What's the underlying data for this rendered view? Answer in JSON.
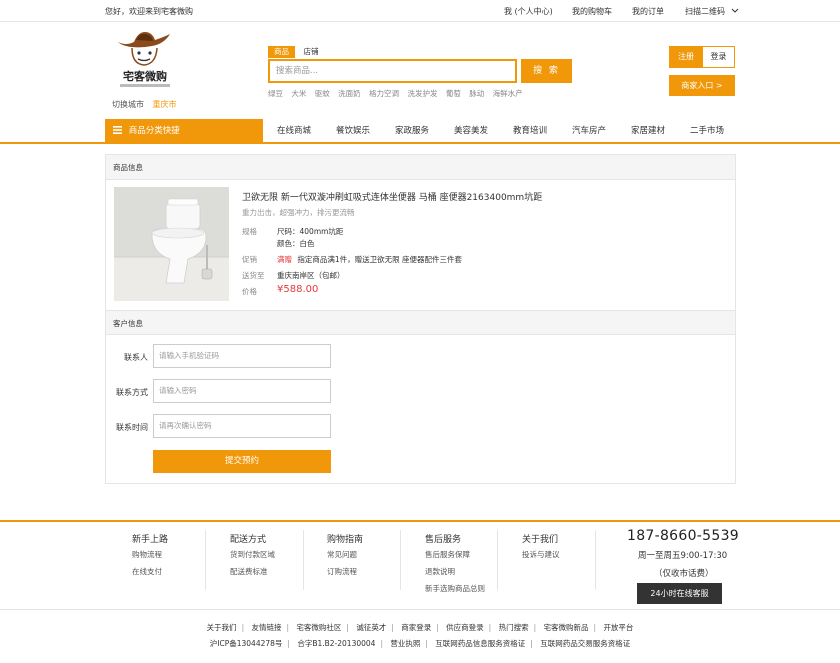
{
  "topbar": {
    "greeting": "您好，欢迎来到宅客微购",
    "links": [
      "我 (个人中心)",
      "我的购物车",
      "我的订单",
      "扫描二维码"
    ]
  },
  "header": {
    "logo_text": "宅客微购",
    "city_label": "切换城市",
    "city_current": "重庆市",
    "search_tabs": [
      "商品",
      "店铺"
    ],
    "search_placeholder": "搜索商品...",
    "search_button": "搜 索",
    "hotwords": [
      "绿豆",
      "大米",
      "驱蚊",
      "洗面奶",
      "格力空调",
      "洗发护发",
      "葡萄",
      "脉动",
      "海鲜水产"
    ],
    "register": "注册",
    "login": "登录",
    "merchant": "商家入口 >"
  },
  "nav": {
    "category": "商品分类快捷",
    "items": [
      "在线商城",
      "餐饮娱乐",
      "家政服务",
      "美容美发",
      "教育培训",
      "汽车房产",
      "家居建材",
      "二手市场"
    ]
  },
  "product": {
    "section_title": "商品信息",
    "title": "卫欲无限 新一代双漩冲刷虹吸式连体坐便器 马桶 座便器2163400mm坑距",
    "subtitle": "重力出击，超强冲力，排污更流畅",
    "spec_label": "规格",
    "spec_size": "尺码：400mm坑距",
    "spec_color": "颜色：白色",
    "promo_label": "促销",
    "promo_tag": "满赠",
    "promo_text": "指定商品满1件，赠送卫欲无限 座便器配件三件套",
    "ship_label": "送货至",
    "ship_value": "重庆南岸区（包邮）",
    "price_label": "价格",
    "price": "¥588.00"
  },
  "customer": {
    "section_title": "客户信息",
    "fields": [
      {
        "label": "联系人",
        "placeholder": "请输入手机验证码"
      },
      {
        "label": "联系方式",
        "placeholder": "请输入密码"
      },
      {
        "label": "联系时间",
        "placeholder": "请再次确认密码"
      }
    ],
    "submit": "提交预约"
  },
  "footer": {
    "columns": [
      {
        "title": "新手上路",
        "links": [
          "购物流程",
          "在线支付"
        ]
      },
      {
        "title": "配送方式",
        "links": [
          "货到付款区域",
          "配送费标准"
        ]
      },
      {
        "title": "购物指南",
        "links": [
          "常见问题",
          "订购流程"
        ]
      },
      {
        "title": "售后服务",
        "links": [
          "售后服务保障",
          "退款说明",
          "新手选购商品总则"
        ]
      },
      {
        "title": "关于我们",
        "links": [
          "投诉与建议"
        ]
      }
    ],
    "phone": "187-8660-5539",
    "hours": "周一至周五9:00-17:30",
    "fee": "（仅收市话费）",
    "service": "24小时在线客服",
    "bottom_links": [
      "关于我们",
      "友情链接",
      "宅客微购社区",
      "诚征英才",
      "商家登录",
      "供应商登录",
      "热门搜索",
      "宅客微购新品",
      "开放平台"
    ],
    "license_links": [
      "沪ICP备13044278号",
      "合字B1.B2-20130004",
      "营业执照",
      "互联网药品信息服务资格证",
      "互联网药品交易服务资格证"
    ]
  },
  "colors": {
    "accent": "#f0980a",
    "price": "#e4393c"
  }
}
